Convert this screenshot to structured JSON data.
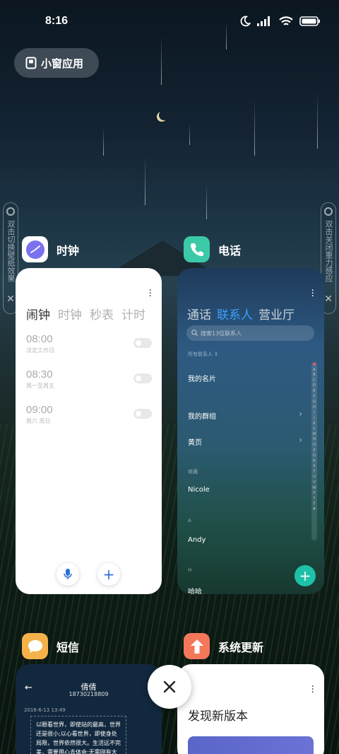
{
  "status_bar": {
    "time": "8:16",
    "icons": [
      "moon-icon",
      "signal-icon",
      "wifi-icon",
      "battery-icon"
    ]
  },
  "floating_window": {
    "label": "小窗应用",
    "icon": "floating-window-icon"
  },
  "side_hints": {
    "left": "双击切换壁纸效果",
    "right": "双击关闭重力感应"
  },
  "apps": {
    "clock": {
      "name": "时钟",
      "icon_color": "#6c6cf0",
      "tabs": [
        "闹钟",
        "时钟",
        "秒表",
        "计时"
      ],
      "alarms": [
        {
          "time": "08:00",
          "subtitle": "法定工作日"
        },
        {
          "time": "08:30",
          "subtitle": "周一至周五"
        },
        {
          "time": "09:00",
          "subtitle": "周六 周日"
        }
      ],
      "mic_icon": "mic-icon",
      "add_icon": "plus-icon"
    },
    "phone": {
      "name": "电话",
      "icon_color": "#3cc9a8",
      "tabs": [
        "通话",
        "联系人",
        "营业厅"
      ],
      "active_tab": "联系人",
      "search_placeholder": "搜索13位联系人",
      "all_contacts": "所有联系人",
      "my_card": "我的名片",
      "rows": [
        "我的群组",
        "黄页"
      ],
      "section_favorites": "收藏",
      "favorite": "Nicole",
      "section_a": "A",
      "contact_a": "Andy",
      "section_h": "H",
      "contact_h": "哈哈",
      "alphabet": "ABCDEFGHIJKLMNOPQRSTUVWXYZ#"
    },
    "sms": {
      "name": "短信",
      "icon_color": "#f5b24a",
      "contact_name": "倩倩",
      "contact_number": "18730218809",
      "date": "2016-6-13 13:49",
      "message": "以眼看世界，即使站的最高，世界还是很小;以心看世界，即使身处局限，世界依然很大。生活远不完美，需要用心去体会;无需刚有大"
    },
    "update": {
      "name": "系统更新",
      "icon_color": "#f4775a",
      "title": "发现新版本"
    }
  },
  "close_all_icon": "close-icon"
}
